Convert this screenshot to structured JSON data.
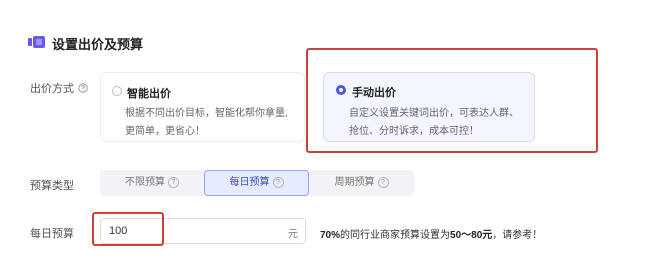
{
  "section": {
    "title": "设置出价及预算",
    "icon": "bid-settings-icon"
  },
  "bid_method": {
    "label": "出价方式",
    "options": [
      {
        "title": "智能出价",
        "desc_lines": [
          "根据不同出价目标，智能化帮你拿量,",
          "更简单，更省心！"
        ],
        "selected": false
      },
      {
        "title": "手动出价",
        "desc_lines": [
          "自定义设置关键词出价，可表达人群、",
          "抢位、分时诉求，成本可控！"
        ],
        "selected": true
      }
    ]
  },
  "budget_type": {
    "label": "预算类型",
    "options": [
      {
        "label": "不限预算",
        "active": false
      },
      {
        "label": "每日预算",
        "active": true
      },
      {
        "label": "周期预算",
        "active": false
      }
    ]
  },
  "daily_budget": {
    "label": "每日预算",
    "value": "100",
    "unit": "元",
    "hint_pre": "70%",
    "hint_mid": "的同行业商家预算设置为",
    "hint_range": "50～80元",
    "hint_post": "，请参考！"
  },
  "colors": {
    "accent": "#4a57e3",
    "annotation_red": "#c8443a",
    "selected_bg": "#f3f5ff"
  }
}
